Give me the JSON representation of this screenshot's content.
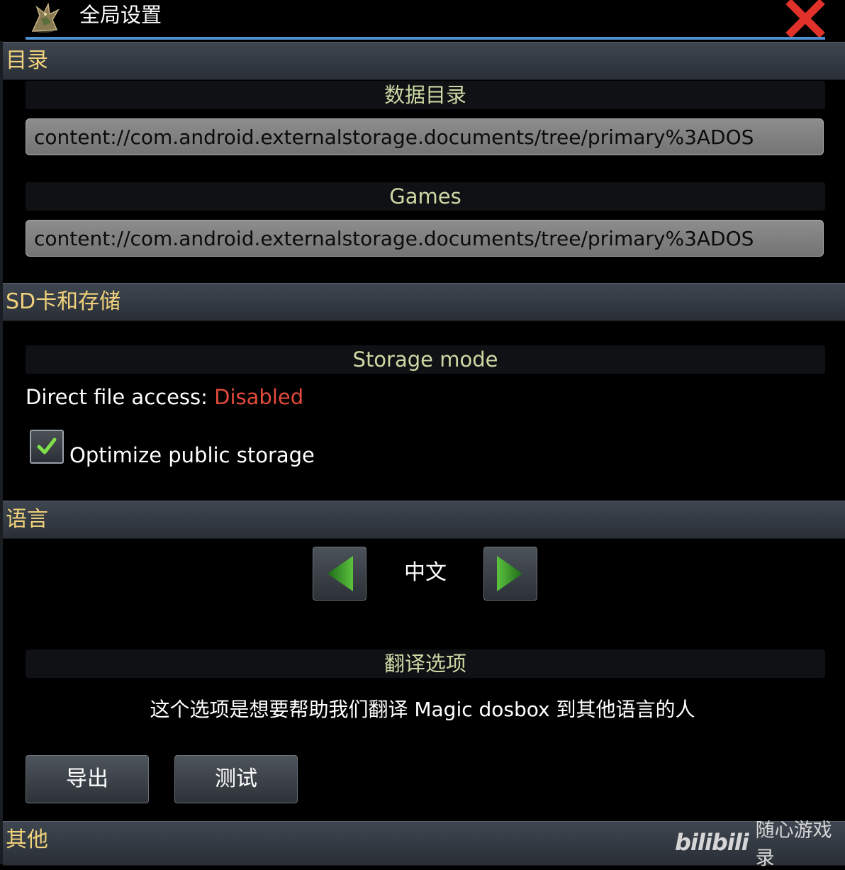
{
  "window": {
    "title": "全局设置",
    "icon": "dragon-app-icon",
    "close_icon": "close-x-icon"
  },
  "sections": {
    "directory": {
      "header": "目录",
      "data_dir": {
        "label": "数据目录",
        "value": "content://com.android.externalstorage.documents/tree/primary%3ADOS"
      },
      "games_dir": {
        "label": "Games",
        "value": "content://com.android.externalstorage.documents/tree/primary%3ADOS"
      }
    },
    "storage": {
      "header": "SD卡和存储",
      "mode_label": "Storage mode",
      "direct_access_label": "Direct file access:",
      "direct_access_value": "Disabled",
      "optimize_label": "Optimize public storage",
      "optimize_checked": true
    },
    "language": {
      "header": "语言",
      "current": "中文",
      "prev_icon": "arrow-left-icon",
      "next_icon": "arrow-right-icon",
      "translation_label": "翻译选项",
      "translation_desc": "这个选项是想要帮助我们翻译 Magic dosbox 到其他语言的人",
      "export_button": "导出",
      "test_button": "测试"
    },
    "other": {
      "header": "其他"
    }
  },
  "watermark": {
    "logo": "bilibili",
    "text": "随心游戏录"
  },
  "colors": {
    "header_text": "#f1d27a",
    "subheader_text": "#cbd9a4",
    "disabled": "#e34a3c",
    "accent_line": "#4f8fd0",
    "arrow_green": "#3fa02e",
    "close_red": "#e0322b"
  }
}
